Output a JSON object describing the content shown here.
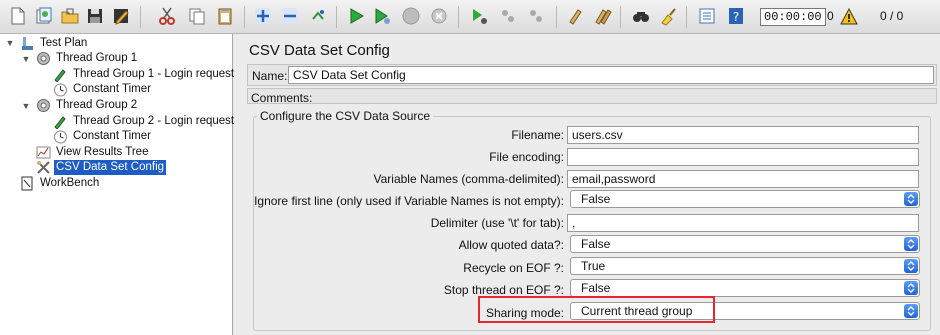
{
  "toolbar": {
    "timer": "00:00:00",
    "warning_count": "0",
    "thread_ratio": "0 / 0",
    "buttons": [
      "new",
      "templates",
      "open",
      "save",
      "save-as",
      "cut",
      "copy",
      "paste",
      "expand",
      "collapse",
      "toggle",
      "start",
      "start-no-pause",
      "stop",
      "shutdown",
      "remote-start",
      "remote-stop",
      "remote-exit",
      "clear",
      "clear-all",
      "search",
      "reset-search",
      "function-helper",
      "help"
    ]
  },
  "tree": {
    "items": [
      {
        "label": "Test Plan",
        "icon": "test-plan-icon"
      },
      {
        "label": "Thread Group 1",
        "icon": "thread-group-icon"
      },
      {
        "label": "Thread Group 1 - Login request",
        "icon": "sampler-icon"
      },
      {
        "label": "Constant Timer",
        "icon": "timer-icon"
      },
      {
        "label": "Thread Group 2",
        "icon": "thread-group-icon"
      },
      {
        "label": "Thread Group 2 - Login request",
        "icon": "sampler-icon"
      },
      {
        "label": "Constant Timer",
        "icon": "timer-icon"
      },
      {
        "label": "View Results Tree",
        "icon": "listener-icon"
      },
      {
        "label": "CSV Data Set Config",
        "icon": "config-icon"
      },
      {
        "label": "WorkBench",
        "icon": "workbench-icon"
      }
    ]
  },
  "panel": {
    "title": "CSV Data Set Config",
    "name_label": "Name:",
    "name_value": "CSV Data Set Config",
    "comments_label": "Comments:",
    "group_title": "Configure the CSV Data Source",
    "fields": {
      "filename": {
        "label": "Filename:",
        "value": "users.csv"
      },
      "encoding": {
        "label": "File encoding:",
        "value": ""
      },
      "varnames": {
        "label": "Variable Names (comma-delimited):",
        "value": "email,password"
      },
      "ignore_first": {
        "label": "Ignore first line (only used if Variable Names is not empty):",
        "value": "False"
      },
      "delimiter": {
        "label": "Delimiter (use '\\t' for tab):",
        "value": ","
      },
      "quoted": {
        "label": "Allow quoted data?:",
        "value": "False"
      },
      "recycle": {
        "label": "Recycle on EOF ?:",
        "value": "True"
      },
      "stop_thread": {
        "label": "Stop thread on EOF ?:",
        "value": "False"
      },
      "sharing": {
        "label": "Sharing mode:",
        "value": "Current thread group"
      }
    }
  },
  "colors": {
    "selection": "#1d5cc4",
    "highlight": "#e8262d",
    "select_arrow": "#1f64d6"
  }
}
